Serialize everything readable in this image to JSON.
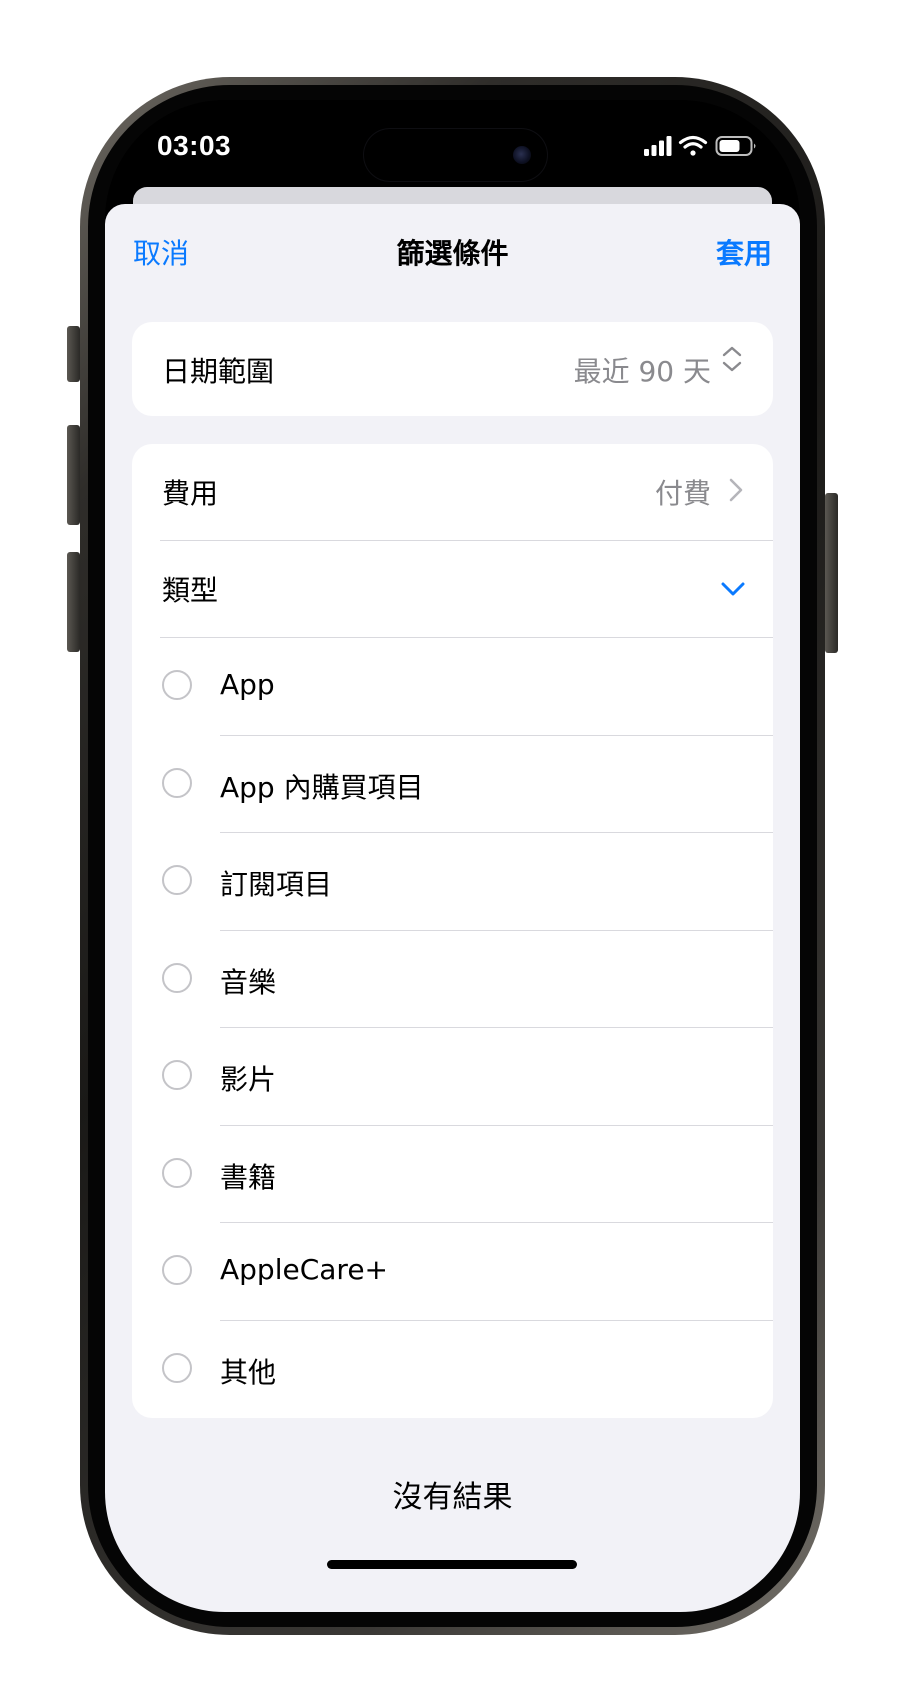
{
  "status_bar": {
    "time": "03:03",
    "icons": [
      "cellular-signal-icon",
      "wifi-icon",
      "battery-icon"
    ]
  },
  "nav": {
    "cancel_label": "取消",
    "title": "篩選條件",
    "apply_label": "套用"
  },
  "date_range": {
    "label": "日期範圍",
    "value": "最近 90 天",
    "icon": "chevron-up-down-icon"
  },
  "filters": {
    "cost": {
      "label": "費用",
      "value": "付費",
      "icon": "chevron-right-icon"
    },
    "type": {
      "label": "類型",
      "icon": "chevron-down-icon"
    },
    "type_options": [
      {
        "label": "App",
        "selected": false
      },
      {
        "label": "App 內購買項目",
        "selected": false
      },
      {
        "label": "訂閱項目",
        "selected": false
      },
      {
        "label": "音樂",
        "selected": false
      },
      {
        "label": "影片",
        "selected": false
      },
      {
        "label": "書籍",
        "selected": false
      },
      {
        "label": "AppleCare+",
        "selected": false
      },
      {
        "label": "其他",
        "selected": false
      }
    ]
  },
  "results": {
    "empty_text": "沒有結果"
  },
  "colors": {
    "accent": "#0a7aff",
    "sheet_background": "#f2f2f7",
    "secondary_text": "#8a8a8e",
    "separator": "#d9d9de"
  }
}
